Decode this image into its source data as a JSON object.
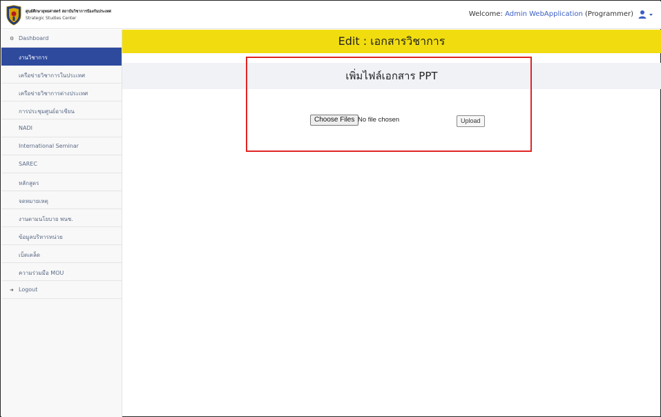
{
  "header": {
    "brand_thai": "ศูนย์ศึกษายุทธศาสตร์ สถาบันวิชาการป้องกันประเทศ",
    "brand_english": "Strategic Studies Center",
    "welcome_prefix": "Welcome:",
    "user_name": "Admin WebApplication",
    "user_role": "(Programmer)",
    "logo_icon": "shield-emblem-icon",
    "user_icon": "user-icon"
  },
  "sidebar": {
    "dashboard": "Dashboard",
    "items": [
      "งานวิชาการ",
      "เครือข่ายวิชาการในประเทศ",
      "เครือข่ายวิชาการต่างประเทศ",
      "การประชุมศูนย์อาเซียน",
      "NADI",
      "International Seminar",
      "SAREC",
      "หลักสูตร",
      "จดหมายเหตุ",
      "งานตามนโยบาย พนช.",
      "ข้อมูลบริหารหน่วย",
      "เบ็ดเตล็ด",
      "ความร่วมมือ MOU"
    ],
    "active_index": 0,
    "logout": "Logout"
  },
  "main": {
    "title": "Edit : เอกสารวิชาการ",
    "card_title": "เพิ่มไฟล์เอกสาร PPT",
    "choose_files": "Choose Files",
    "file_status": "No file chosen",
    "upload": "Upload"
  },
  "colors": {
    "active_nav": "#2e4a9d",
    "banner": "#f1dd0f",
    "highlight": "#e02222",
    "link": "#3b5fc5"
  }
}
